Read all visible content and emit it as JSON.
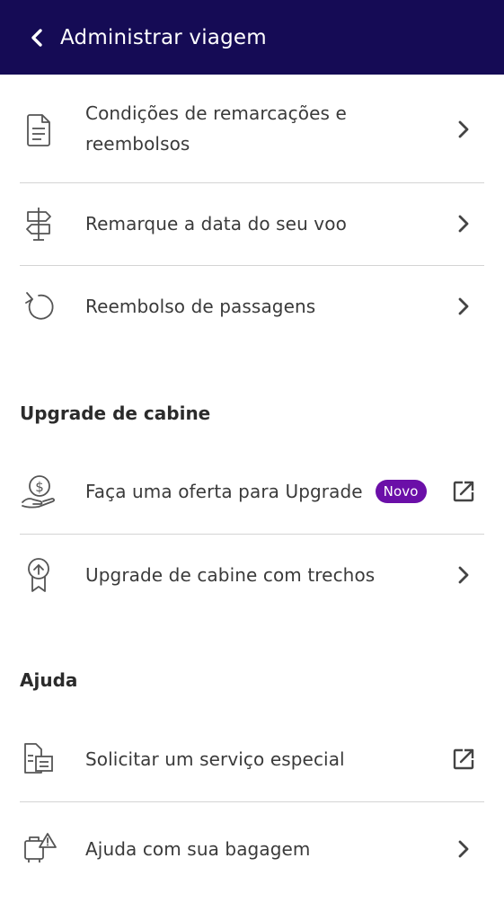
{
  "header": {
    "title": "Administrar viagem",
    "back_icon": "chevron-left-icon"
  },
  "sections": {
    "manage": {
      "items": [
        {
          "line1": "Condições de remarcações e",
          "line2": "reembolsos",
          "icon": "document-icon",
          "action": "chevron-right-icon"
        },
        {
          "label": "Remarque a data do seu voo",
          "icon": "signpost-icon",
          "action": "chevron-right-icon"
        },
        {
          "label": "Reembolso de passagens",
          "icon": "refund-arrow-icon",
          "action": "chevron-right-icon"
        }
      ]
    },
    "upgrade": {
      "title": "Upgrade de cabine",
      "items": [
        {
          "label": "Faça uma oferta para Upgrade",
          "badge": "Novo",
          "icon": "dollar-hand-icon",
          "action": "external-link-icon"
        },
        {
          "label": "Upgrade de cabine com trechos",
          "icon": "upgrade-ribbon-icon",
          "action": "chevron-right-icon"
        }
      ]
    },
    "help": {
      "title": "Ajuda",
      "items": [
        {
          "label": "Solicitar um serviço especial",
          "icon": "special-service-icon",
          "action": "external-link-icon"
        },
        {
          "label": "Ajuda com sua bagagem",
          "icon": "baggage-alert-icon",
          "action": "chevron-right-icon"
        }
      ]
    }
  },
  "colors": {
    "header_bg": "#150b55",
    "badge_bg": "#6b0fa8",
    "divider": "#d4d4d4",
    "text": "#3a3a3a"
  }
}
